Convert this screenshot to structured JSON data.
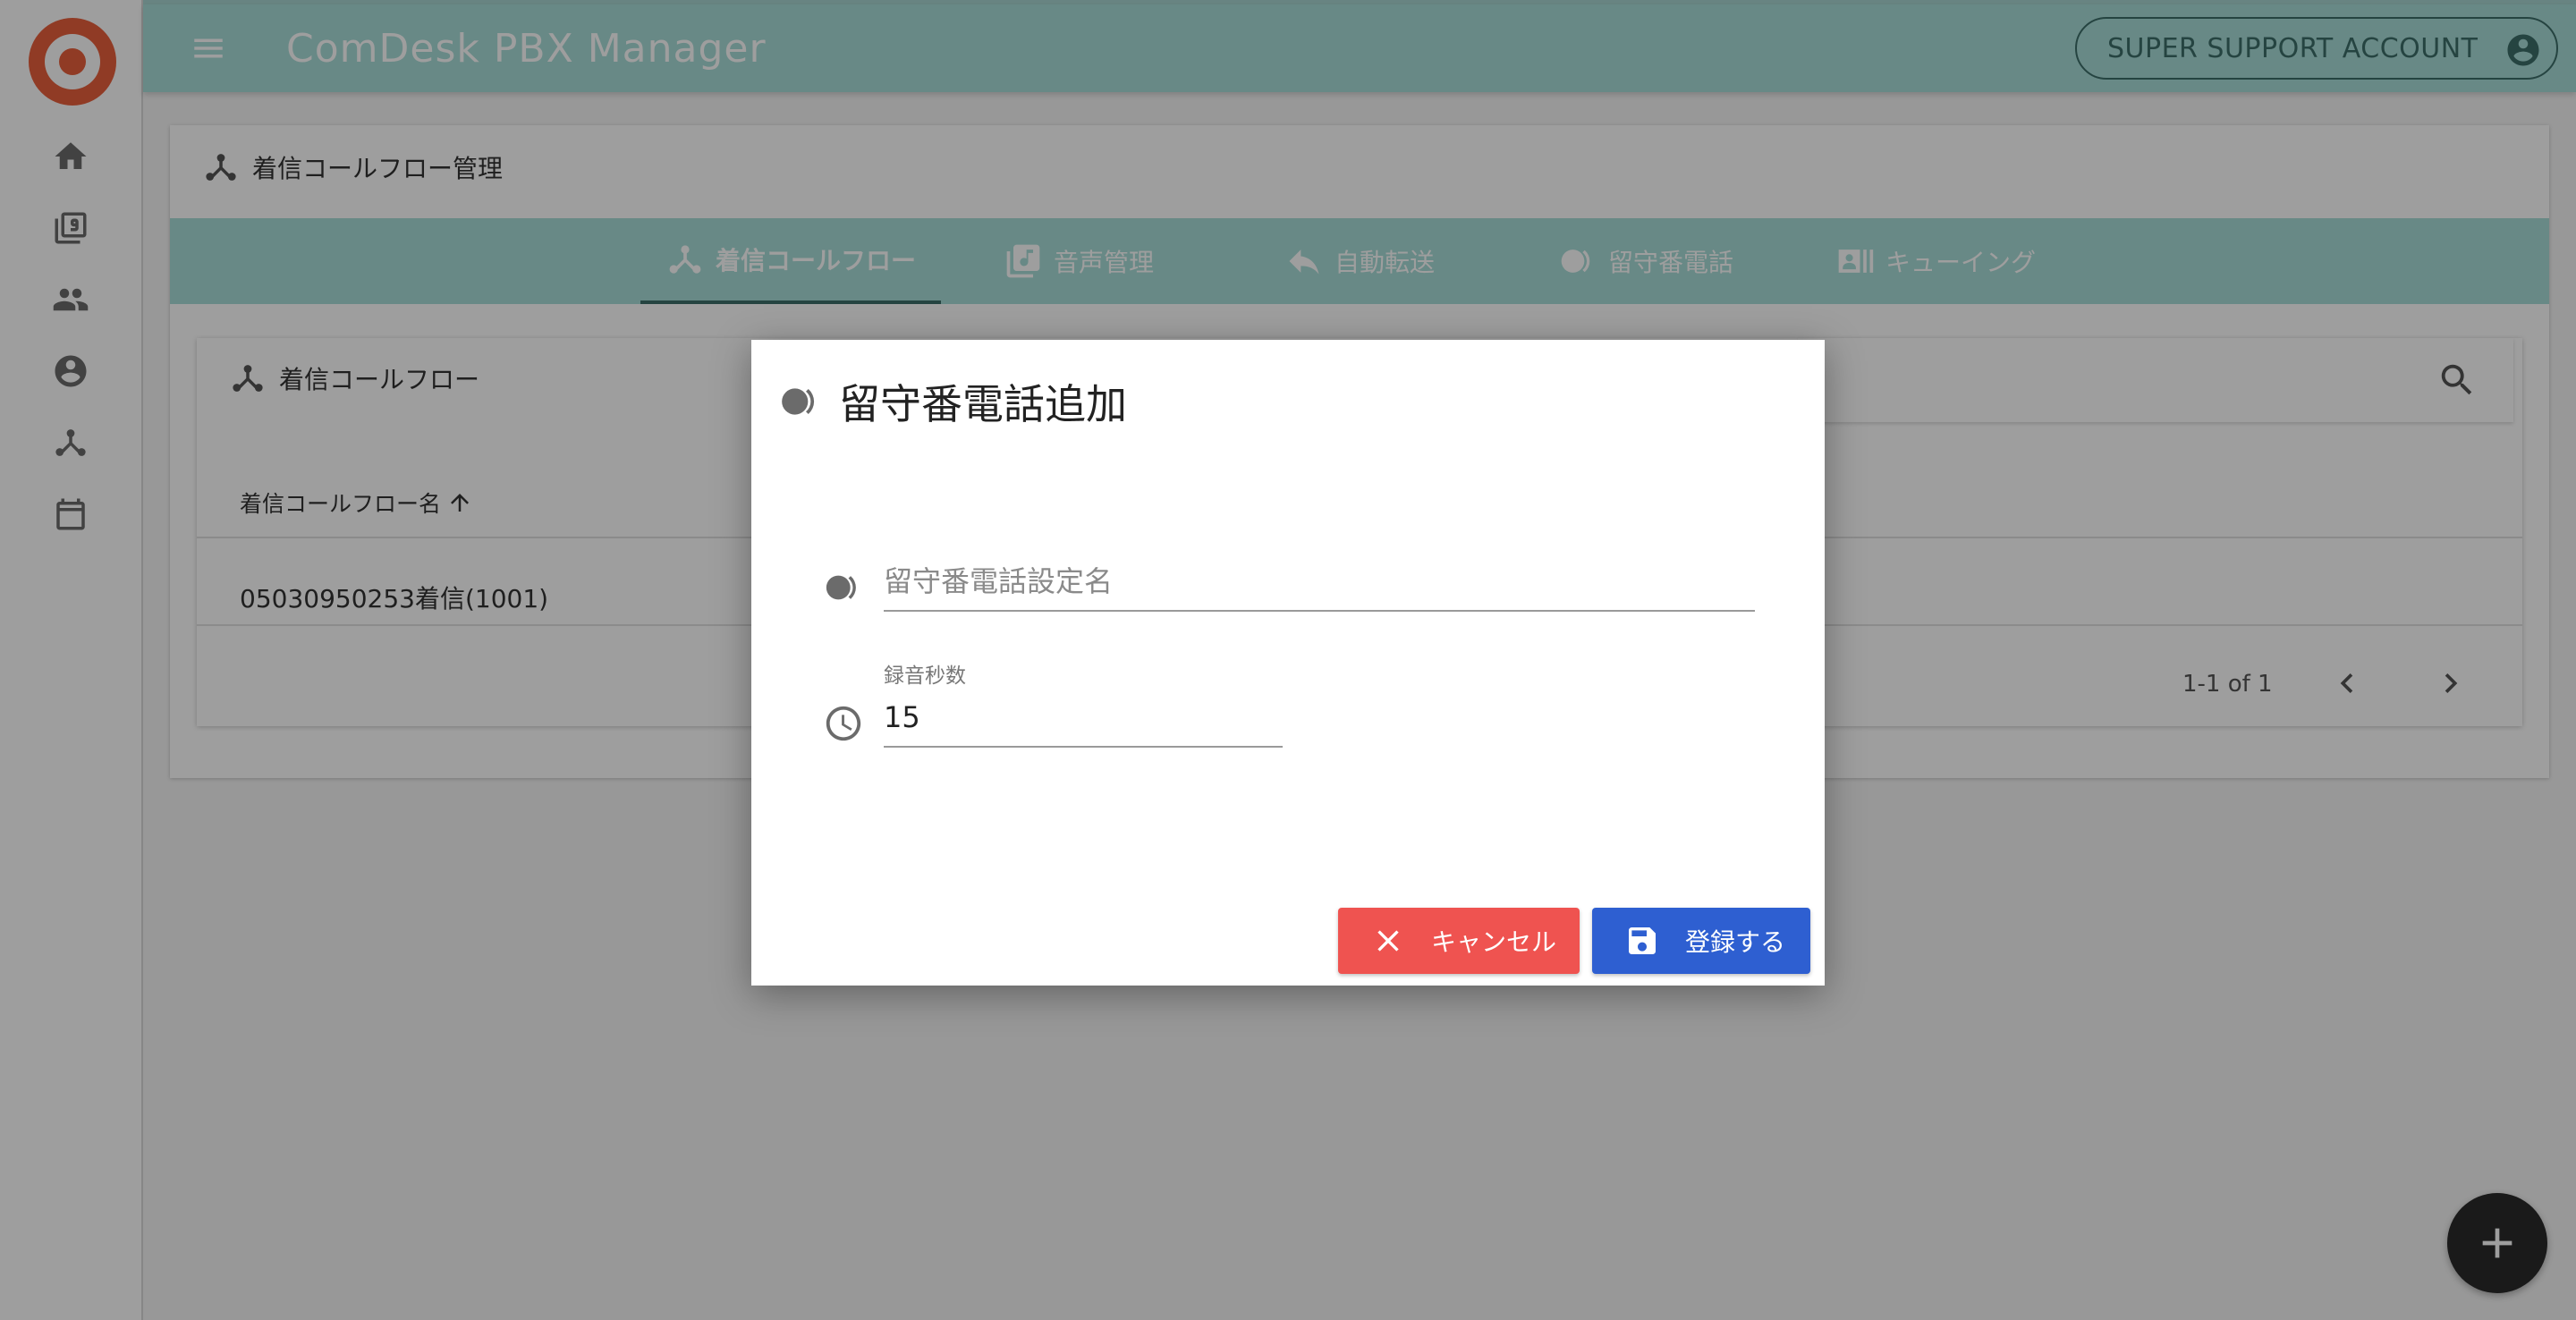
{
  "app": {
    "title": "ComDesk PBX Manager",
    "account_label": "SUPER SUPPORT ACCOUNT"
  },
  "sidebar": {
    "items": [
      {
        "icon": "home-icon"
      },
      {
        "icon": "library-icon"
      },
      {
        "icon": "people-icon"
      },
      {
        "icon": "account-circle-icon"
      },
      {
        "icon": "call-flow-icon"
      },
      {
        "icon": "calendar-icon"
      }
    ]
  },
  "page": {
    "title": "着信コールフロー管理",
    "tabs": [
      {
        "label": "着信コールフロー",
        "icon": "call-flow-icon",
        "active": true
      },
      {
        "label": "音声管理",
        "icon": "audio-library-icon",
        "active": false
      },
      {
        "label": "自動転送",
        "icon": "reply-icon",
        "active": false
      },
      {
        "label": "留守番電話",
        "icon": "voicemail-icon",
        "active": false
      },
      {
        "label": "キューイング",
        "icon": "queue-icon",
        "active": false
      }
    ]
  },
  "table_card": {
    "title": "着信コールフロー",
    "column_header": "着信コールフロー名",
    "rows": [
      {
        "name": "05030950253着信(1001)"
      }
    ],
    "pagination": "1-1 of 1"
  },
  "dialog": {
    "title": "留守番電話追加",
    "name_field": {
      "placeholder": "留守番電話設定名",
      "value": ""
    },
    "seconds_field": {
      "label": "録音秒数",
      "value": "15"
    },
    "cancel_label": "キャンセル",
    "save_label": "登録する"
  },
  "colors": {
    "appbar": "#a9ddd8",
    "cancel": "#ef5350",
    "save": "#2e5fd1"
  }
}
